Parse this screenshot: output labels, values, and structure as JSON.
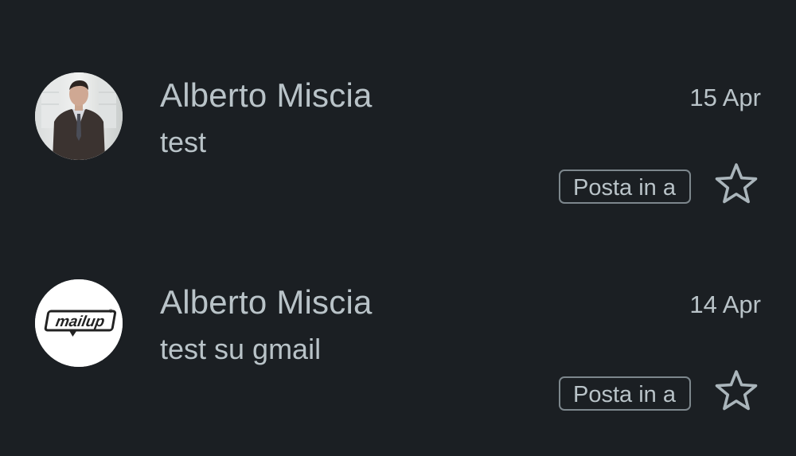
{
  "messages": [
    {
      "sender": "Alberto Miscia",
      "subject": "test",
      "date": "15 Apr",
      "label": "Posta in a",
      "avatar": "person-photo"
    },
    {
      "sender": "Alberto Miscia",
      "subject": "test su gmail",
      "date": "14 Apr",
      "label": "Posta in a",
      "avatar": "mailup-logo",
      "avatar_logo_text": "mailup"
    }
  ],
  "colors": {
    "background": "#1b1f23",
    "text": "#b9c3c8",
    "chip_border": "#7d878d",
    "star_outline": "#aab5bb"
  }
}
